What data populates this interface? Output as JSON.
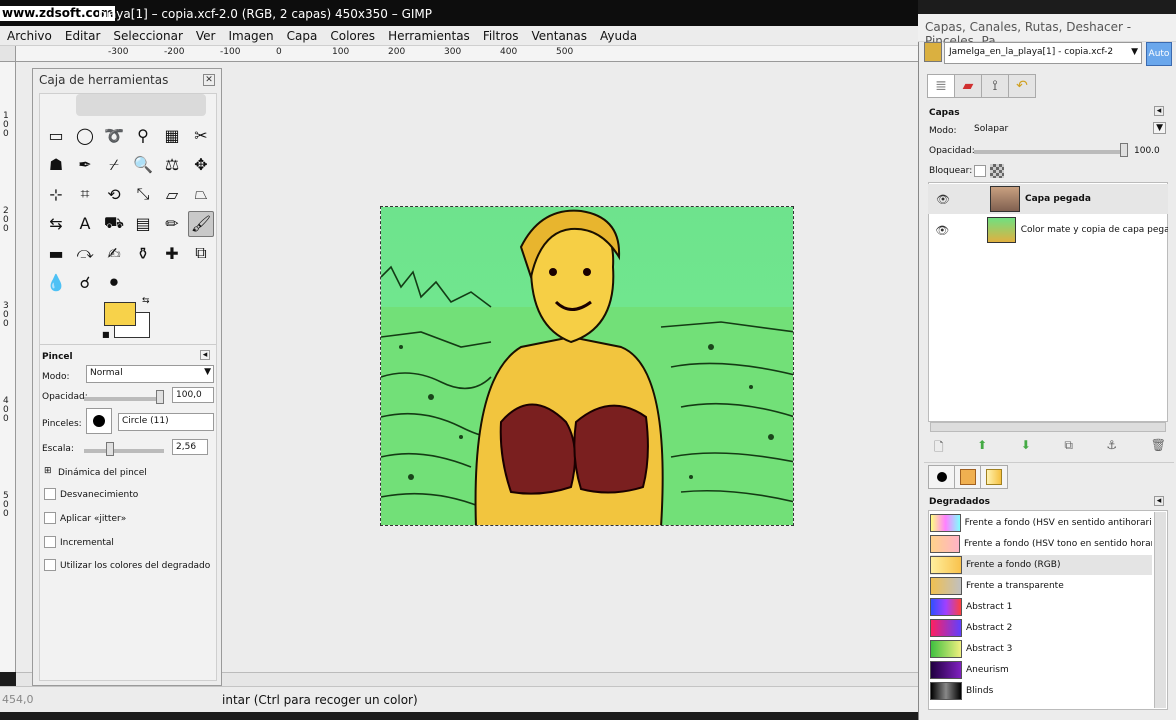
{
  "watermark": "www.zdsoft.com",
  "window_title": "playa[1] – copia.xcf-2.0 (RGB, 2 capas) 450x350 – GIMP",
  "menu": [
    "Archivo",
    "Editar",
    "Seleccionar",
    "Ver",
    "Imagen",
    "Capa",
    "Colores",
    "Herramientas",
    "Filtros",
    "Ventanas",
    "Ayuda"
  ],
  "ruler_h": [
    "-300",
    "-200",
    "-100",
    "0",
    "100",
    "200",
    "300",
    "400",
    "500"
  ],
  "ruler_v": [
    "1\n0\n0",
    "2\n0\n0",
    "3\n0\n0",
    "4\n0\n0",
    "5\n0\n0"
  ],
  "status": {
    "coords": "454,0",
    "message": "intar (Ctrl para recoger un color)"
  },
  "toolbox": {
    "title": "Caja de herramientas",
    "tools": [
      {
        "icon": "rect-select-icon",
        "glyph": "▭"
      },
      {
        "icon": "ellipse-select-icon",
        "glyph": "◯"
      },
      {
        "icon": "lasso-icon",
        "glyph": "➰"
      },
      {
        "icon": "fuzzy-select-icon",
        "glyph": "⚲"
      },
      {
        "icon": "color-select-icon",
        "glyph": "▦"
      },
      {
        "icon": "scissors-icon",
        "glyph": "✂"
      },
      {
        "icon": "foreground-select-icon",
        "glyph": "☗"
      },
      {
        "icon": "paths-icon",
        "glyph": "✒"
      },
      {
        "icon": "color-picker-icon",
        "glyph": "⌿"
      },
      {
        "icon": "zoom-icon",
        "glyph": "🔍"
      },
      {
        "icon": "measure-icon",
        "glyph": "⚖"
      },
      {
        "icon": "move-icon",
        "glyph": "✥"
      },
      {
        "icon": "align-icon",
        "glyph": "⊹"
      },
      {
        "icon": "crop-icon",
        "glyph": "⌗"
      },
      {
        "icon": "rotate-icon",
        "glyph": "⟲"
      },
      {
        "icon": "scale-icon",
        "glyph": "⤡"
      },
      {
        "icon": "shear-icon",
        "glyph": "▱"
      },
      {
        "icon": "perspective-icon",
        "glyph": "⏢"
      },
      {
        "icon": "flip-icon",
        "glyph": "⇆"
      },
      {
        "icon": "text-icon",
        "glyph": "A"
      },
      {
        "icon": "bucket-fill-icon",
        "glyph": "⛟"
      },
      {
        "icon": "blend-icon",
        "glyph": "▤"
      },
      {
        "icon": "pencil-icon",
        "glyph": "✏"
      },
      {
        "icon": "paintbrush-icon",
        "glyph": "🖌"
      },
      {
        "icon": "eraser-icon",
        "glyph": "▬"
      },
      {
        "icon": "airbrush-icon",
        "glyph": "⤼"
      },
      {
        "icon": "ink-icon",
        "glyph": "✍"
      },
      {
        "icon": "clone-icon",
        "glyph": "⚱"
      },
      {
        "icon": "heal-icon",
        "glyph": "✚"
      },
      {
        "icon": "perspective-clone-icon",
        "glyph": "⧉"
      },
      {
        "icon": "blur-icon",
        "glyph": "💧"
      },
      {
        "icon": "smudge-icon",
        "glyph": "☌"
      },
      {
        "icon": "dodge-burn-icon",
        "glyph": "⚫"
      }
    ],
    "fg_color": "#f7d24a",
    "bg_color": "#ffffff"
  },
  "tool_options": {
    "title": "Pincel",
    "mode_label": "Modo:",
    "mode_value": "Normal",
    "opacity_label": "Opacidad:",
    "opacity_value": "100,0",
    "opacity": 1.0,
    "brush_label": "Pinceles:",
    "brush_value": "Circle (11)",
    "scale_label": "Escala:",
    "scale_value": "2,56",
    "scale": 0.27,
    "dynamics_label": "Dinámica del pincel",
    "fade_label": "Desvanecimiento",
    "jitter_label": "Aplicar «jitter»",
    "incremental_label": "Incremental",
    "gradient_colors_label": "Utilizar los colores del degradado"
  },
  "dock": {
    "title": "Capas, Canales, Rutas, Deshacer - Pinceles, Pa...",
    "image_selector": "Jamelga_en_la_playa[1] - copia.xcf-2",
    "auto_label": "Auto",
    "tabs": [
      "layers-tab-icon",
      "channels-tab-icon",
      "paths-tab-icon",
      "undo-tab-icon"
    ],
    "layers": {
      "title": "Capas",
      "mode_label": "Modo:",
      "mode_value": "Solapar",
      "opacity_label": "Opacidad:",
      "opacity_value": "100.0",
      "opacity": 1.0,
      "lock_label": "Bloquear:",
      "items": [
        {
          "name": "Capa pegada",
          "bold": true
        },
        {
          "name": "Color mate y copia de capa pegad",
          "bold": false
        }
      ]
    },
    "gradients": {
      "title": "Degradados",
      "items": [
        {
          "name": "Frente a fondo (HSV en sentido antihorario)",
          "colors": [
            "#ffff80",
            "#ff80ff",
            "#80ffff"
          ]
        },
        {
          "name": "Frente a fondo (HSV tono en sentido horario)",
          "colors": [
            "#ffd28a",
            "#ffb3c6"
          ]
        },
        {
          "name": "Frente a fondo (RGB)",
          "colors": [
            "#ffef9e",
            "#f9c24c"
          ]
        },
        {
          "name": "Frente a transparente",
          "colors": [
            "#f0c050",
            "#c0c0c0"
          ]
        },
        {
          "name": "Abstract 1",
          "colors": [
            "#3050ff",
            "#a040ff",
            "#ff4040"
          ]
        },
        {
          "name": "Abstract 2",
          "colors": [
            "#ff2060",
            "#6040ff"
          ]
        },
        {
          "name": "Abstract 3",
          "colors": [
            "#40c040",
            "#f0f080"
          ]
        },
        {
          "name": "Aneurism",
          "colors": [
            "#200040",
            "#8020c0"
          ]
        },
        {
          "name": "Blinds",
          "colors": [
            "#000",
            "#888",
            "#000"
          ]
        }
      ]
    }
  }
}
